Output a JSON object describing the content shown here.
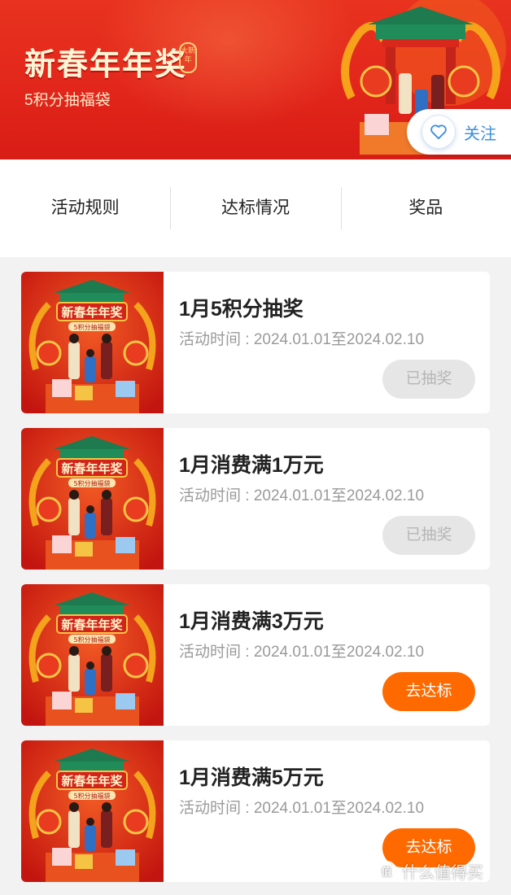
{
  "banner": {
    "title": "新春年年奖",
    "seal_text": "大新年",
    "subtitle": "5积分抽福袋",
    "follow_label": "关注"
  },
  "tabs": [
    {
      "label": "活动规则"
    },
    {
      "label": "达标情况"
    },
    {
      "label": "奖品"
    }
  ],
  "cards": [
    {
      "title": "1月5积分抽奖",
      "time": "活动时间 : 2024.01.01至2024.02.10",
      "button": "已抽奖",
      "state": "disabled"
    },
    {
      "title": "1月消费满1万元",
      "time": "活动时间 : 2024.01.01至2024.02.10",
      "button": "已抽奖",
      "state": "disabled"
    },
    {
      "title": "1月消费满3万元",
      "time": "活动时间 : 2024.01.01至2024.02.10",
      "button": "去达标",
      "state": "active"
    },
    {
      "title": "1月消费满5万元",
      "time": "活动时间 : 2024.01.01至2024.02.10",
      "button": "去达标",
      "state": "active"
    }
  ],
  "thumb": {
    "title": "新春年年奖",
    "subtitle": "5积分抽福袋"
  },
  "watermark": {
    "logo": "值",
    "text": "什么值得买"
  },
  "colors": {
    "banner_red": "#e2261b",
    "accent_orange": "#ff6a00",
    "follow_blue": "#3b8fe0"
  }
}
